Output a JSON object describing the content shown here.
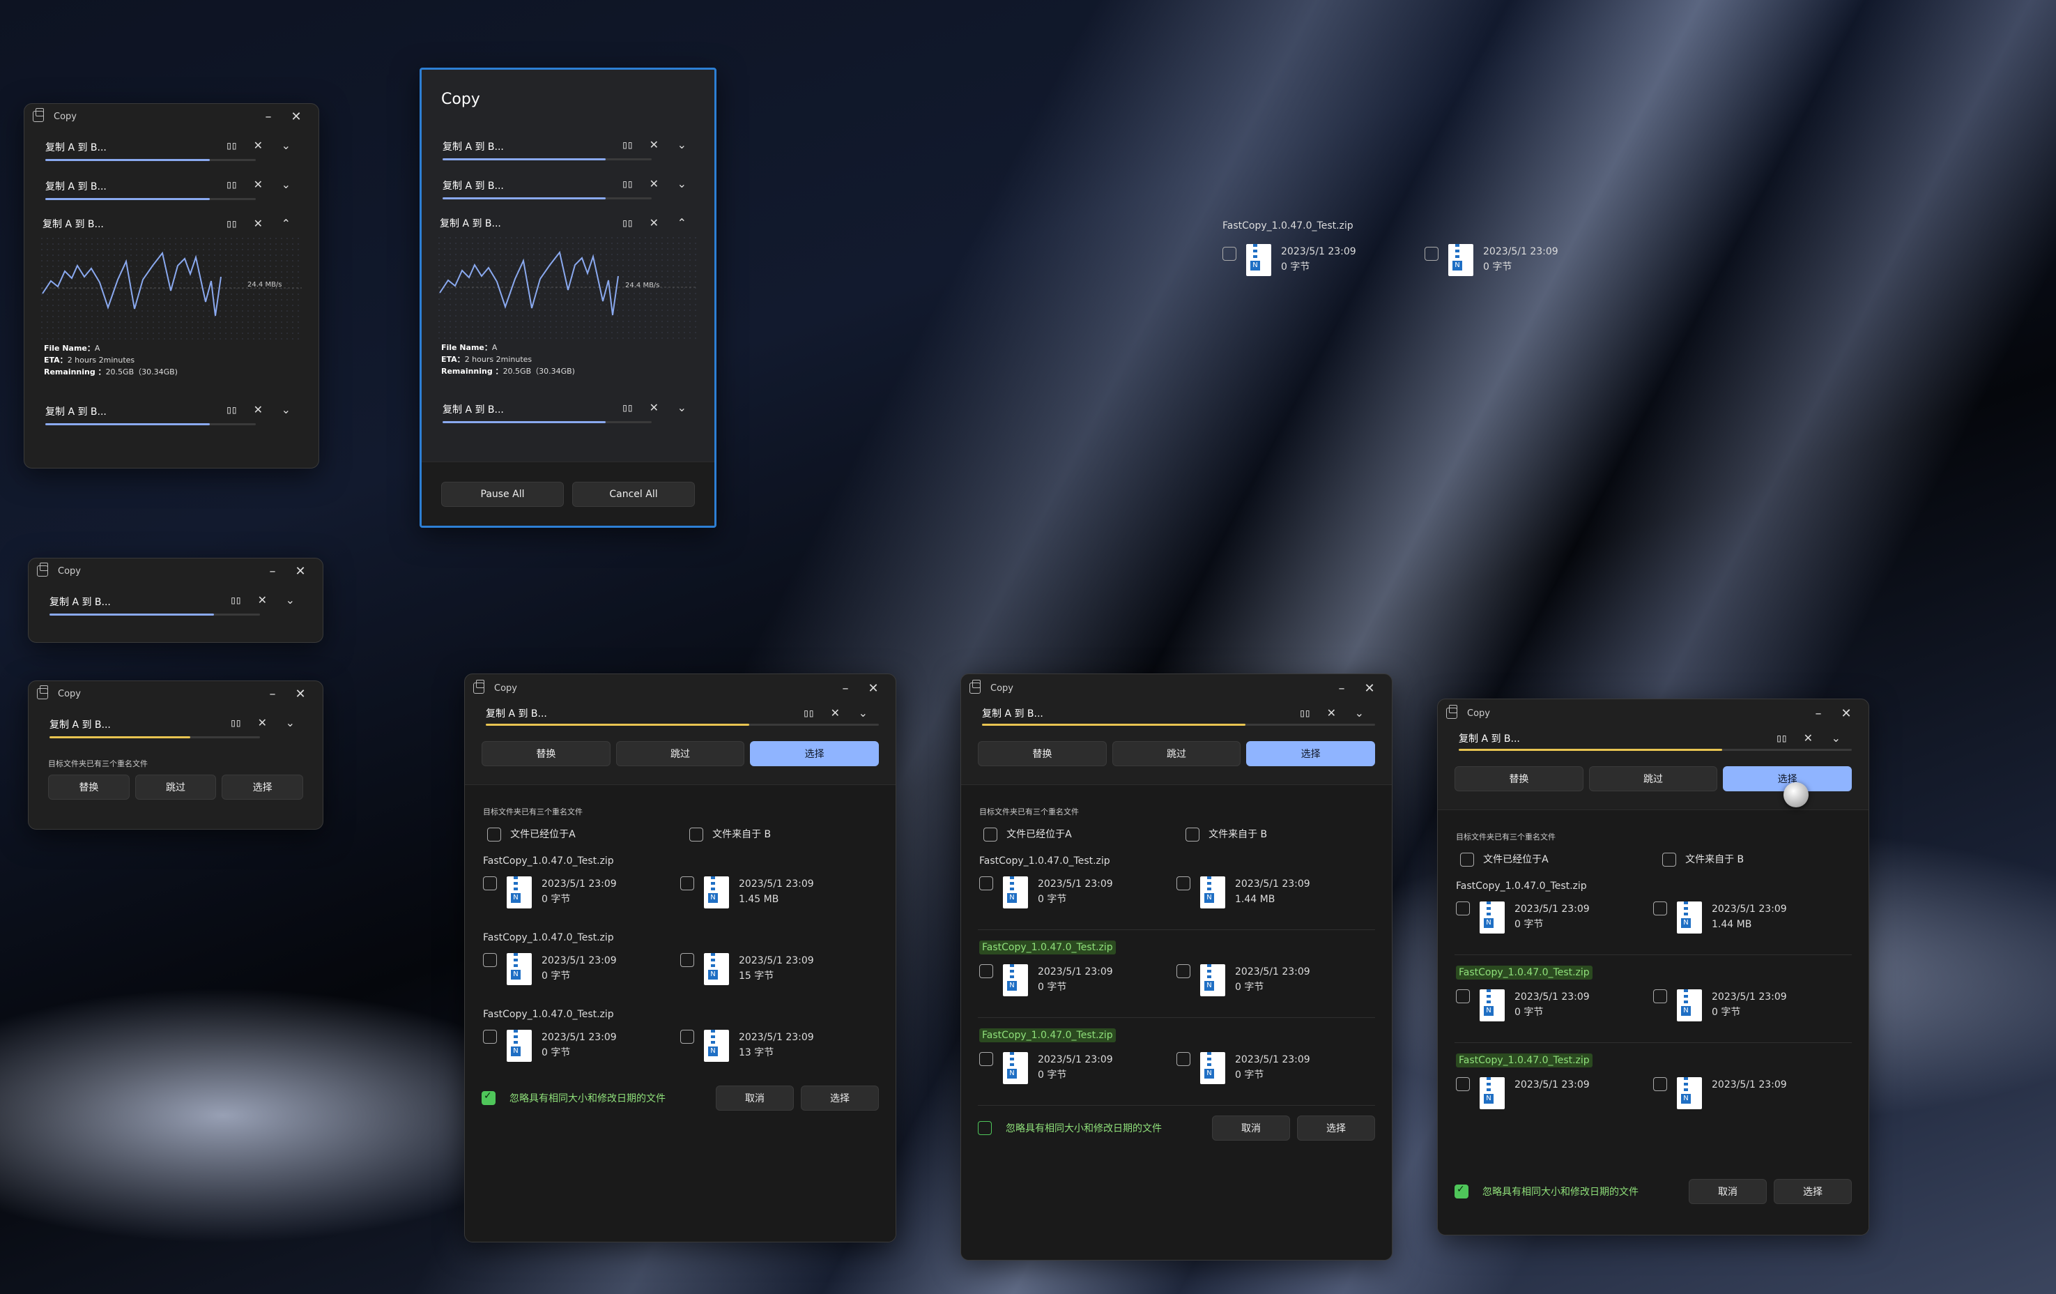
{
  "app": {
    "title": "Copy"
  },
  "task_label": "复制 A 到 B...",
  "chart": {
    "speed": "24.4 MB/s"
  },
  "info": {
    "file_name_label": "File Name：",
    "file_name": "A",
    "eta_label": "ETA：",
    "eta": "2 hours 2minutes",
    "remaining_label": "Remainning ：",
    "remaining": "20.5GB（30.34GB)"
  },
  "actions": {
    "pause_all": "Pause All",
    "cancel_all": "Cancel All"
  },
  "conflict": {
    "note": "目标文件夹已有三个重名文件",
    "replace": "替换",
    "skip": "跳过",
    "choose": "选择",
    "col_a": "文件已经位于A",
    "col_b": "文件来自于 B",
    "ignore_same": "忽略具有相同大小和修改日期的文件",
    "cancel": "取消",
    "select": "选择"
  },
  "files": {
    "name": "FastCopy_1.0.47.0_Test.zip",
    "date": "2023/5/1 23:09",
    "size_zero": "0 字节",
    "size_145": "1.45 MB",
    "size_144": "1.44 MB",
    "size_15": "15 字节",
    "size_13": "13 字节"
  },
  "progress": {
    "blue": 0.78,
    "yellow": 0.67
  },
  "colors": {
    "accent": "#8fb4ff",
    "progress_blue": "#8aa9ef",
    "progress_yellow": "#e8c451",
    "focus_border": "#2d7fd4",
    "ok_green": "#4fc65a"
  }
}
